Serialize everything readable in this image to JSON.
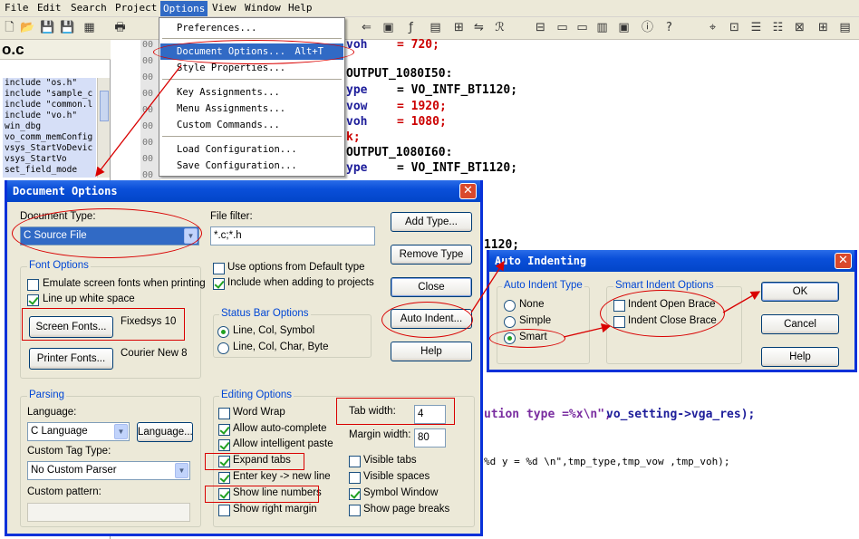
{
  "menubar": {
    "items": [
      "File",
      "Edit",
      "Search",
      "Project",
      "Options",
      "View",
      "Window",
      "Help"
    ]
  },
  "left_panel": {
    "file_header": "o.c",
    "symbols": [
      "include \"os.h\"",
      "include \"sample_c",
      "include \"common.l",
      "include \"vo.h\"",
      "win_dbg",
      "vo_comm_memConfig",
      "vsys_StartVoDevic",
      "vsys_StartVo",
      "set_field_mode"
    ]
  },
  "editor": {
    "line_numbers": [
      "00",
      "00",
      "00",
      "00",
      "00",
      "00",
      "00",
      "00",
      "00"
    ],
    "code": {
      "l1a": "voh",
      "l1b": "= 720;",
      "l2": "OUTPUT_1080I50:",
      "l3a": "ype",
      "l3b": "= VO_INTF_BT1120;",
      "l4a": "vow",
      "l4b": "= 1920;",
      "l5a": "voh",
      "l5b": "= 1080;",
      "l6": "k;",
      "l7": "OUTPUT_1080I60:",
      "l8a": "ype",
      "l8b": "= VO_INTF_BT1120;",
      "l9": "1120;",
      "l10a": "ution type =%x\\n\",",
      "l10b": "vo_setting->vga_res);",
      "l11": "%d y = %d \\n\",tmp_type,tmp_vow ,tmp_voh);"
    }
  },
  "options_menu": {
    "items": [
      {
        "label": "Preferences...",
        "shortcut": ""
      },
      {
        "label": "Document Options...",
        "shortcut": "Alt+T"
      },
      {
        "label": "Style Properties...",
        "shortcut": ""
      },
      {
        "label": "Key Assignments...",
        "shortcut": ""
      },
      {
        "label": "Menu Assignments...",
        "shortcut": ""
      },
      {
        "label": "Custom Commands...",
        "shortcut": ""
      },
      {
        "label": "Load Configuration...",
        "shortcut": ""
      },
      {
        "label": "Save Configuration...",
        "shortcut": ""
      }
    ]
  },
  "document_options": {
    "title": "Document Options",
    "document_type_label": "Document Type:",
    "document_type_value": "C Source File",
    "file_filter_label": "File filter:",
    "file_filter_value": "*.c;*.h",
    "buttons": {
      "add_type": "Add Type...",
      "remove_type": "Remove Type",
      "close": "Close",
      "auto_indent": "Auto Indent...",
      "help": "Help",
      "screen_fonts": "Screen Fonts...",
      "printer_fonts": "Printer Fonts...",
      "language": "Language..."
    },
    "font_options": {
      "title": "Font Options",
      "emulate": "Emulate screen fonts when printing",
      "line_up": "Line up white space",
      "screen_font_value": "Fixedsys 10",
      "printer_font_value": "Courier New 8"
    },
    "use_default": "Use options from Default type",
    "include_projects": "Include when adding to projects",
    "status_bar": {
      "title": "Status Bar Options",
      "opt1": "Line, Col, Symbol",
      "opt2": "Line, Col, Char, Byte"
    },
    "parsing": {
      "title": "Parsing",
      "language_label": "Language:",
      "language_value": "C Language",
      "custom_tag_label": "Custom Tag Type:",
      "custom_tag_value": "No Custom Parser",
      "custom_pattern_label": "Custom pattern:"
    },
    "editing": {
      "title": "Editing Options",
      "word_wrap": "Word Wrap",
      "auto_complete": "Allow auto-complete",
      "intelligent_paste": "Allow intelligent paste",
      "expand_tabs": "Expand tabs",
      "enter_key": "Enter key -> new line",
      "show_line_numbers": "Show line numbers",
      "show_right_margin": "Show right margin",
      "tab_width_label": "Tab width:",
      "tab_width_value": "4",
      "margin_width_label": "Margin width:",
      "margin_width_value": "80",
      "visible_tabs": "Visible tabs",
      "visible_spaces": "Visible spaces",
      "symbol_window": "Symbol Window",
      "show_page_breaks": "Show page breaks"
    }
  },
  "auto_indent": {
    "title": "Auto Indenting",
    "type_group": "Auto Indent Type",
    "none": "None",
    "simple": "Simple",
    "smart": "Smart",
    "smart_group": "Smart Indent Options",
    "indent_open": "Indent Open Brace",
    "indent_close": "Indent Close Brace",
    "ok": "OK",
    "cancel": "Cancel",
    "help": "Help"
  },
  "colors": {
    "highlight": "#316ac5",
    "annotation": "#d90000",
    "titlebar": "#0a4fd9",
    "dialog_bg": "#ece9d8"
  }
}
